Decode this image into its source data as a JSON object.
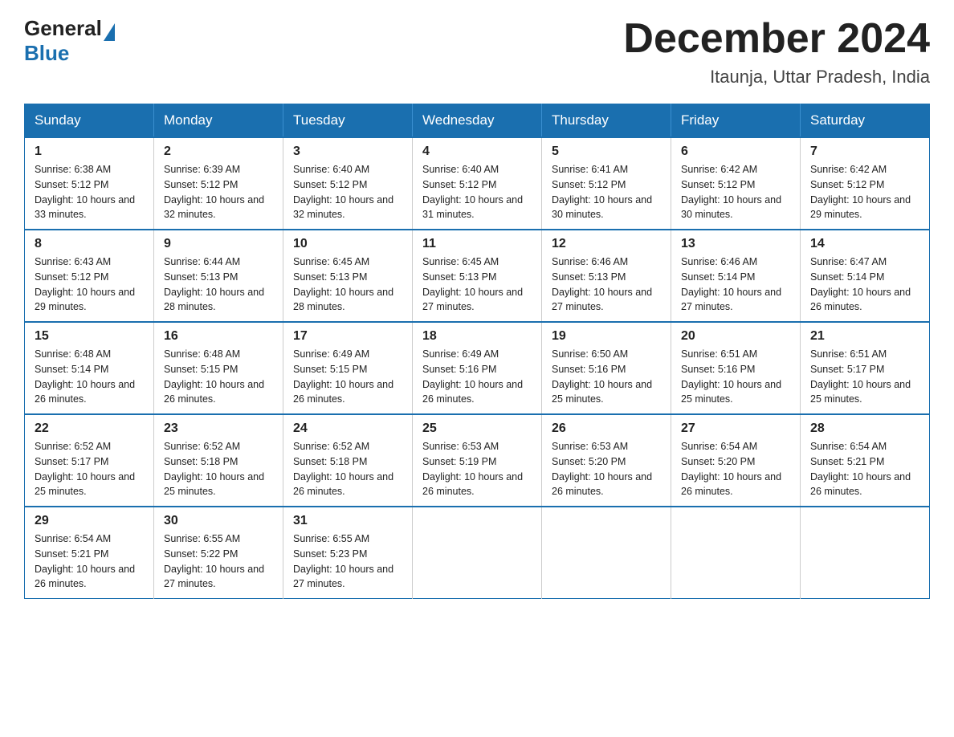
{
  "header": {
    "logo_general": "General",
    "logo_blue": "Blue",
    "title": "December 2024",
    "subtitle": "Itaunja, Uttar Pradesh, India"
  },
  "weekdays": [
    "Sunday",
    "Monday",
    "Tuesday",
    "Wednesday",
    "Thursday",
    "Friday",
    "Saturday"
  ],
  "weeks": [
    [
      {
        "day": "1",
        "sunrise": "6:38 AM",
        "sunset": "5:12 PM",
        "daylight": "10 hours and 33 minutes."
      },
      {
        "day": "2",
        "sunrise": "6:39 AM",
        "sunset": "5:12 PM",
        "daylight": "10 hours and 32 minutes."
      },
      {
        "day": "3",
        "sunrise": "6:40 AM",
        "sunset": "5:12 PM",
        "daylight": "10 hours and 32 minutes."
      },
      {
        "day": "4",
        "sunrise": "6:40 AM",
        "sunset": "5:12 PM",
        "daylight": "10 hours and 31 minutes."
      },
      {
        "day": "5",
        "sunrise": "6:41 AM",
        "sunset": "5:12 PM",
        "daylight": "10 hours and 30 minutes."
      },
      {
        "day": "6",
        "sunrise": "6:42 AM",
        "sunset": "5:12 PM",
        "daylight": "10 hours and 30 minutes."
      },
      {
        "day": "7",
        "sunrise": "6:42 AM",
        "sunset": "5:12 PM",
        "daylight": "10 hours and 29 minutes."
      }
    ],
    [
      {
        "day": "8",
        "sunrise": "6:43 AM",
        "sunset": "5:12 PM",
        "daylight": "10 hours and 29 minutes."
      },
      {
        "day": "9",
        "sunrise": "6:44 AM",
        "sunset": "5:13 PM",
        "daylight": "10 hours and 28 minutes."
      },
      {
        "day": "10",
        "sunrise": "6:45 AM",
        "sunset": "5:13 PM",
        "daylight": "10 hours and 28 minutes."
      },
      {
        "day": "11",
        "sunrise": "6:45 AM",
        "sunset": "5:13 PM",
        "daylight": "10 hours and 27 minutes."
      },
      {
        "day": "12",
        "sunrise": "6:46 AM",
        "sunset": "5:13 PM",
        "daylight": "10 hours and 27 minutes."
      },
      {
        "day": "13",
        "sunrise": "6:46 AM",
        "sunset": "5:14 PM",
        "daylight": "10 hours and 27 minutes."
      },
      {
        "day": "14",
        "sunrise": "6:47 AM",
        "sunset": "5:14 PM",
        "daylight": "10 hours and 26 minutes."
      }
    ],
    [
      {
        "day": "15",
        "sunrise": "6:48 AM",
        "sunset": "5:14 PM",
        "daylight": "10 hours and 26 minutes."
      },
      {
        "day": "16",
        "sunrise": "6:48 AM",
        "sunset": "5:15 PM",
        "daylight": "10 hours and 26 minutes."
      },
      {
        "day": "17",
        "sunrise": "6:49 AM",
        "sunset": "5:15 PM",
        "daylight": "10 hours and 26 minutes."
      },
      {
        "day": "18",
        "sunrise": "6:49 AM",
        "sunset": "5:16 PM",
        "daylight": "10 hours and 26 minutes."
      },
      {
        "day": "19",
        "sunrise": "6:50 AM",
        "sunset": "5:16 PM",
        "daylight": "10 hours and 25 minutes."
      },
      {
        "day": "20",
        "sunrise": "6:51 AM",
        "sunset": "5:16 PM",
        "daylight": "10 hours and 25 minutes."
      },
      {
        "day": "21",
        "sunrise": "6:51 AM",
        "sunset": "5:17 PM",
        "daylight": "10 hours and 25 minutes."
      }
    ],
    [
      {
        "day": "22",
        "sunrise": "6:52 AM",
        "sunset": "5:17 PM",
        "daylight": "10 hours and 25 minutes."
      },
      {
        "day": "23",
        "sunrise": "6:52 AM",
        "sunset": "5:18 PM",
        "daylight": "10 hours and 25 minutes."
      },
      {
        "day": "24",
        "sunrise": "6:52 AM",
        "sunset": "5:18 PM",
        "daylight": "10 hours and 26 minutes."
      },
      {
        "day": "25",
        "sunrise": "6:53 AM",
        "sunset": "5:19 PM",
        "daylight": "10 hours and 26 minutes."
      },
      {
        "day": "26",
        "sunrise": "6:53 AM",
        "sunset": "5:20 PM",
        "daylight": "10 hours and 26 minutes."
      },
      {
        "day": "27",
        "sunrise": "6:54 AM",
        "sunset": "5:20 PM",
        "daylight": "10 hours and 26 minutes."
      },
      {
        "day": "28",
        "sunrise": "6:54 AM",
        "sunset": "5:21 PM",
        "daylight": "10 hours and 26 minutes."
      }
    ],
    [
      {
        "day": "29",
        "sunrise": "6:54 AM",
        "sunset": "5:21 PM",
        "daylight": "10 hours and 26 minutes."
      },
      {
        "day": "30",
        "sunrise": "6:55 AM",
        "sunset": "5:22 PM",
        "daylight": "10 hours and 27 minutes."
      },
      {
        "day": "31",
        "sunrise": "6:55 AM",
        "sunset": "5:23 PM",
        "daylight": "10 hours and 27 minutes."
      },
      null,
      null,
      null,
      null
    ]
  ]
}
